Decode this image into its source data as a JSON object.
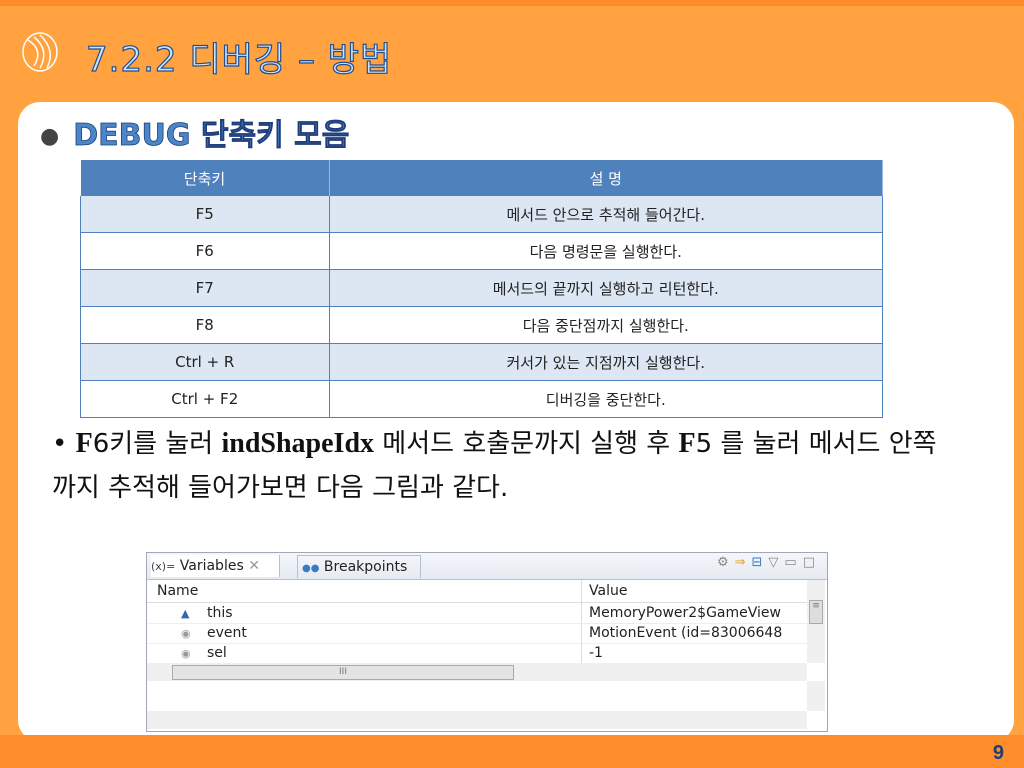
{
  "slide": {
    "title": "7.2.2 디버깅 – 방법",
    "subtitle": "DEBUG 단축키 모음",
    "page": "9"
  },
  "table": {
    "headers": [
      "단축키",
      "설 명"
    ],
    "rows": [
      [
        "F5",
        "메서드 안으로 추적해 들어간다."
      ],
      [
        "F6",
        "다음 명령문을 실행한다."
      ],
      [
        "F7",
        "메서드의 끝까지 실행하고 리턴한다."
      ],
      [
        "F8",
        "다음 중단점까지 실행한다."
      ],
      [
        "Ctrl + R",
        "커서가 있는 지점까지 실행한다."
      ],
      [
        "Ctrl + F2",
        "디버깅을 중단한다."
      ]
    ]
  },
  "bullet": {
    "k1": "F",
    "t1": "6키를 눌러 ",
    "k2": "indShapeIdx",
    "t2": " 메서드 호출문까지 실행 후 ",
    "k3": "F",
    "t3": "5 를 눌러 메서드 안쪽까지 추적해 들어가보면 다음 그림과 같다."
  },
  "eclipse": {
    "tab_variables": "Variables",
    "tab_variables_icon": "(x)=",
    "tab_breakpoints": "Breakpoints",
    "col_name": "Name",
    "col_value": "Value",
    "scroll_mark": "III",
    "vars": [
      {
        "name": "this",
        "value": "MemoryPower2$GameView"
      },
      {
        "name": "event",
        "value": "MotionEvent  (id=83006648"
      },
      {
        "name": "sel",
        "value": "-1"
      }
    ]
  }
}
